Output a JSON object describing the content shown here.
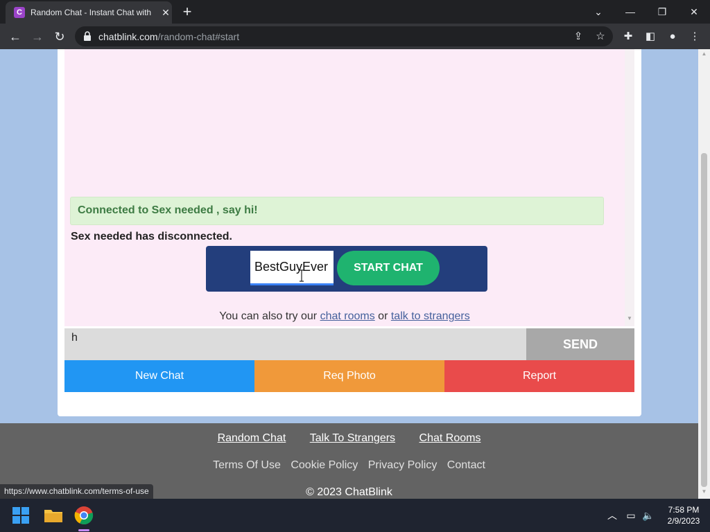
{
  "browser": {
    "tab_title": "Random Chat - Instant Chat with",
    "favicon_letter": "C",
    "url_host": "chatblink.com",
    "url_path": "/random-chat#start"
  },
  "chat": {
    "connected_message": "Connected to Sex needed , say hi!",
    "disconnected_message": "Sex needed has disconnected.",
    "name_value": "BestGuyEver",
    "start_label": "START CHAT",
    "try_prefix": "You can also try our",
    "try_link1": "chat rooms",
    "try_or": "or",
    "try_link2": "talk to strangers",
    "message_value": "h",
    "send_label": "SEND"
  },
  "actions": {
    "new_chat": "New Chat",
    "req_photo": "Req Photo",
    "report": "Report"
  },
  "footer": {
    "links1": [
      "Random Chat",
      "Talk To Strangers",
      "Chat Rooms"
    ],
    "links2": [
      "Terms Of Use",
      "Cookie Policy",
      "Privacy Policy",
      "Contact"
    ],
    "copyright": "© 2023 ChatBlink"
  },
  "status_url": "https://www.chatblink.com/terms-of-use",
  "taskbar": {
    "time": "7:58 PM",
    "date": "2/9/2023"
  },
  "colors": {
    "page_bg": "#a7c2e6",
    "start_box": "#233e7c",
    "start_button": "#1fb36f",
    "new_chat": "#2196f3",
    "req_photo": "#f0993a",
    "report": "#e94b4b",
    "send": "#a8a8a8"
  }
}
